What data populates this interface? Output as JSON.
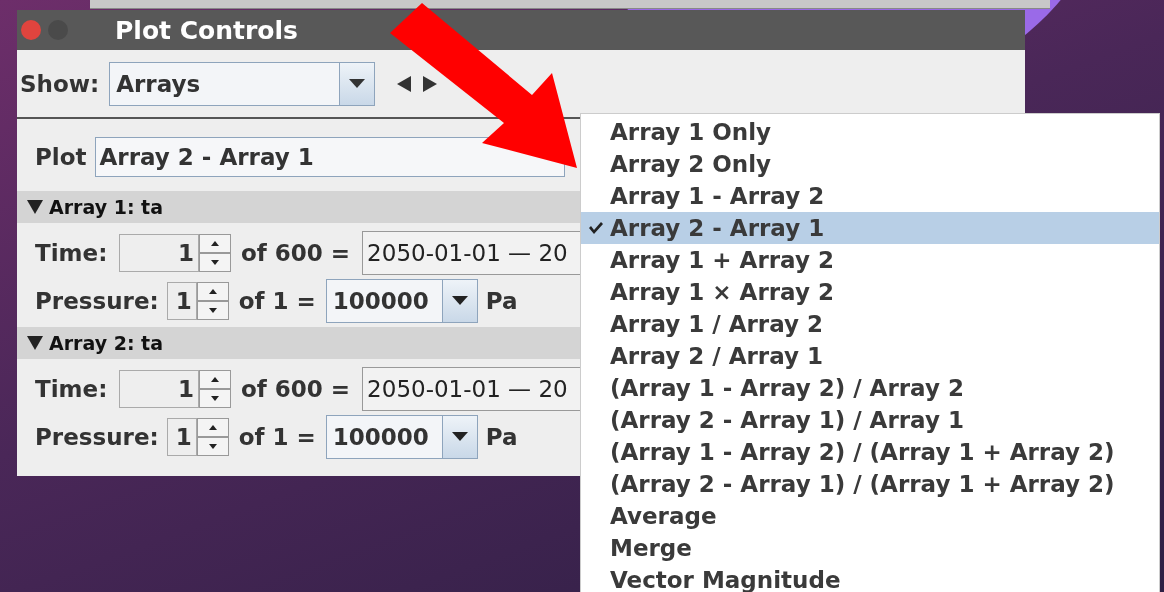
{
  "window": {
    "title": "Plot Controls"
  },
  "show": {
    "label": "Show:",
    "value": "Arrays"
  },
  "plot": {
    "label": "Plot",
    "value": "Array 2 - Array 1"
  },
  "arrays": [
    {
      "title": "Array 1: ta",
      "expanded": true,
      "time": {
        "label": "Time:",
        "value": "1",
        "of": "of 600 =",
        "date": "2050-01-01 — 20"
      },
      "pressure": {
        "label": "Pressure:",
        "value": "1",
        "of": "of 1 =",
        "choice": "100000",
        "unit": "Pa"
      }
    },
    {
      "title": "Array 2: ta",
      "expanded": true,
      "time": {
        "label": "Time:",
        "value": "1",
        "of": "of 600 =",
        "date": "2050-01-01 — 20"
      },
      "pressure": {
        "label": "Pressure:",
        "value": "1",
        "of": "of 1 =",
        "choice": "100000",
        "unit": "Pa"
      }
    }
  ],
  "menu": {
    "items": [
      {
        "label": "Array 1 Only",
        "selected": false
      },
      {
        "label": "Array 2 Only",
        "selected": false
      },
      {
        "label": "Array 1 - Array 2",
        "selected": false
      },
      {
        "label": "Array 2 - Array 1",
        "selected": true
      },
      {
        "label": "Array 1 + Array 2",
        "selected": false
      },
      {
        "label": "Array 1 × Array 2",
        "selected": false
      },
      {
        "label": "Array 1 / Array 2",
        "selected": false
      },
      {
        "label": "Array 2 / Array 1",
        "selected": false
      },
      {
        "label": "(Array 1 - Array 2) / Array 2",
        "selected": false
      },
      {
        "label": "(Array 2 - Array 1) / Array 1",
        "selected": false
      },
      {
        "label": "(Array 1 - Array 2) / (Array 1 + Array 2)",
        "selected": false
      },
      {
        "label": "(Array 2 - Array 1) / (Array 1 + Array 2)",
        "selected": false
      },
      {
        "label": "Average",
        "selected": false
      },
      {
        "label": "Merge",
        "selected": false
      },
      {
        "label": "Vector Magnitude",
        "selected": false
      }
    ]
  }
}
